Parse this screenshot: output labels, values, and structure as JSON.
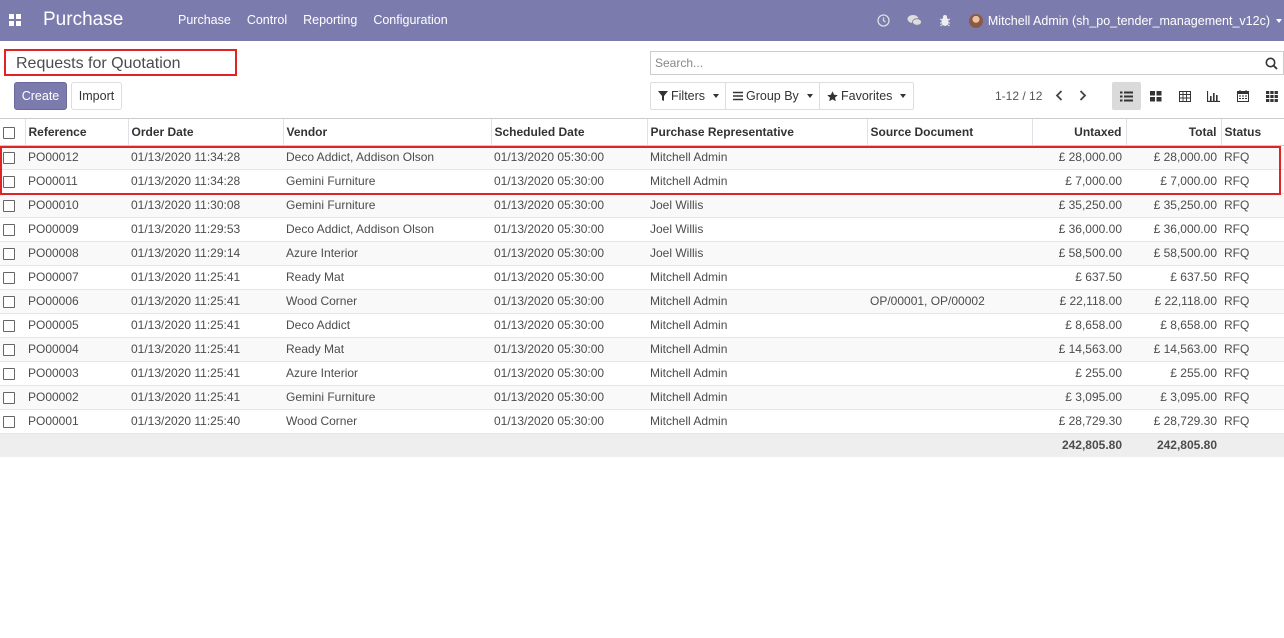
{
  "navbar": {
    "app_name": "Purchase",
    "menu": [
      "Purchase",
      "Control",
      "Reporting",
      "Configuration"
    ],
    "user_name": "Mitchell Admin (sh_po_tender_management_v12c)"
  },
  "control": {
    "page_title": "Requests for Quotation",
    "create_label": "Create",
    "import_label": "Import",
    "search_placeholder": "Search...",
    "filters_label": "Filters",
    "groupby_label": "Group By",
    "favorites_label": "Favorites",
    "pager": "1-12 / 12"
  },
  "table": {
    "columns": [
      "Reference",
      "Order Date",
      "Vendor",
      "Scheduled Date",
      "Purchase Representative",
      "Source Document",
      "Untaxed",
      "Total",
      "Status"
    ],
    "rows": [
      {
        "ref": "PO00012",
        "order_date": "01/13/2020 11:34:28",
        "vendor": "Deco Addict, Addison Olson",
        "scheduled": "01/13/2020 05:30:00",
        "rep": "Mitchell Admin",
        "source": "",
        "untaxed": "£ 28,000.00",
        "total": "£ 28,000.00",
        "status": "RFQ"
      },
      {
        "ref": "PO00011",
        "order_date": "01/13/2020 11:34:28",
        "vendor": "Gemini Furniture",
        "scheduled": "01/13/2020 05:30:00",
        "rep": "Mitchell Admin",
        "source": "",
        "untaxed": "£ 7,000.00",
        "total": "£ 7,000.00",
        "status": "RFQ"
      },
      {
        "ref": "PO00010",
        "order_date": "01/13/2020 11:30:08",
        "vendor": "Gemini Furniture",
        "scheduled": "01/13/2020 05:30:00",
        "rep": "Joel Willis",
        "source": "",
        "untaxed": "£ 35,250.00",
        "total": "£ 35,250.00",
        "status": "RFQ"
      },
      {
        "ref": "PO00009",
        "order_date": "01/13/2020 11:29:53",
        "vendor": "Deco Addict, Addison Olson",
        "scheduled": "01/13/2020 05:30:00",
        "rep": "Joel Willis",
        "source": "",
        "untaxed": "£ 36,000.00",
        "total": "£ 36,000.00",
        "status": "RFQ"
      },
      {
        "ref": "PO00008",
        "order_date": "01/13/2020 11:29:14",
        "vendor": "Azure Interior",
        "scheduled": "01/13/2020 05:30:00",
        "rep": "Joel Willis",
        "source": "",
        "untaxed": "£ 58,500.00",
        "total": "£ 58,500.00",
        "status": "RFQ"
      },
      {
        "ref": "PO00007",
        "order_date": "01/13/2020 11:25:41",
        "vendor": "Ready Mat",
        "scheduled": "01/13/2020 05:30:00",
        "rep": "Mitchell Admin",
        "source": "",
        "untaxed": "£ 637.50",
        "total": "£ 637.50",
        "status": "RFQ"
      },
      {
        "ref": "PO00006",
        "order_date": "01/13/2020 11:25:41",
        "vendor": "Wood Corner",
        "scheduled": "01/13/2020 05:30:00",
        "rep": "Mitchell Admin",
        "source": "OP/00001, OP/00002",
        "untaxed": "£ 22,118.00",
        "total": "£ 22,118.00",
        "status": "RFQ"
      },
      {
        "ref": "PO00005",
        "order_date": "01/13/2020 11:25:41",
        "vendor": "Deco Addict",
        "scheduled": "01/13/2020 05:30:00",
        "rep": "Mitchell Admin",
        "source": "",
        "untaxed": "£ 8,658.00",
        "total": "£ 8,658.00",
        "status": "RFQ"
      },
      {
        "ref": "PO00004",
        "order_date": "01/13/2020 11:25:41",
        "vendor": "Ready Mat",
        "scheduled": "01/13/2020 05:30:00",
        "rep": "Mitchell Admin",
        "source": "",
        "untaxed": "£ 14,563.00",
        "total": "£ 14,563.00",
        "status": "RFQ"
      },
      {
        "ref": "PO00003",
        "order_date": "01/13/2020 11:25:41",
        "vendor": "Azure Interior",
        "scheduled": "01/13/2020 05:30:00",
        "rep": "Mitchell Admin",
        "source": "",
        "untaxed": "£ 255.00",
        "total": "£ 255.00",
        "status": "RFQ"
      },
      {
        "ref": "PO00002",
        "order_date": "01/13/2020 11:25:41",
        "vendor": "Gemini Furniture",
        "scheduled": "01/13/2020 05:30:00",
        "rep": "Mitchell Admin",
        "source": "",
        "untaxed": "£ 3,095.00",
        "total": "£ 3,095.00",
        "status": "RFQ"
      },
      {
        "ref": "PO00001",
        "order_date": "01/13/2020 11:25:40",
        "vendor": "Wood Corner",
        "scheduled": "01/13/2020 05:30:00",
        "rep": "Mitchell Admin",
        "source": "",
        "untaxed": "£ 28,729.30",
        "total": "£ 28,729.30",
        "status": "RFQ"
      }
    ],
    "footer": {
      "untaxed": "242,805.80",
      "total": "242,805.80"
    }
  },
  "colors": {
    "brand": "#7c7bad",
    "highlight": "#e02424"
  }
}
